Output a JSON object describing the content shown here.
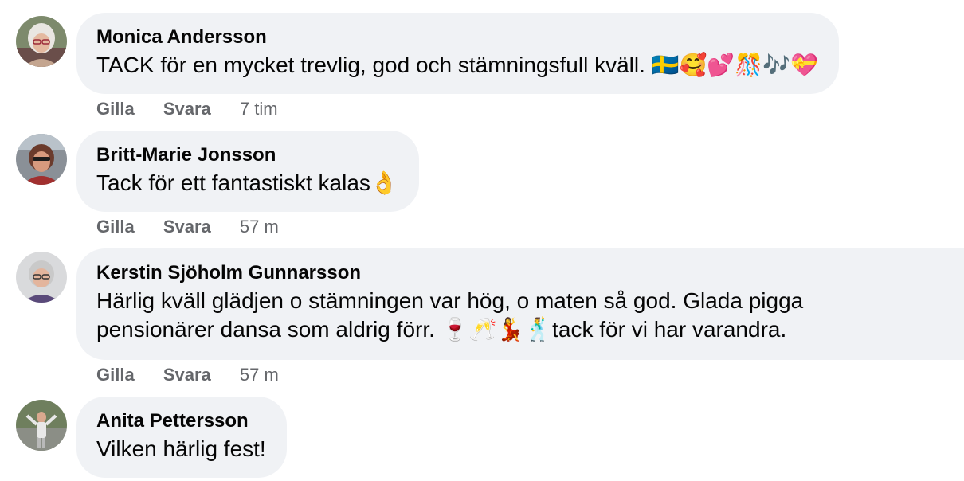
{
  "comments": [
    {
      "author": "Monica Andersson",
      "text": "TACK för en mycket trevlig, god och stämningsfull kväll. 🇸🇪🥰💕🎊🎶💝",
      "like_label": "Gilla",
      "reply_label": "Svara",
      "time": "7 tim",
      "avatar_icon": "avatar-photo-icon"
    },
    {
      "author": "Britt-Marie Jonsson",
      "text": "Tack för ett fantastiskt kalas👌",
      "like_label": "Gilla",
      "reply_label": "Svara",
      "time": "57 m",
      "avatar_icon": "avatar-photo-icon"
    },
    {
      "author": "Kerstin Sjöholm Gunnarsson",
      "text_line1": "Härlig kväll glädjen o stämningen var hög, o maten så god. Glada pigga",
      "text_line2": "pensionärer dansa som aldrig förr. 🍷🥂💃🕺tack för vi har varandra.",
      "like_label": "Gilla",
      "reply_label": "Svara",
      "time": "57 m",
      "avatar_icon": "avatar-photo-icon"
    },
    {
      "author": "Anita Pettersson",
      "text": "Vilken härlig fest!",
      "avatar_icon": "avatar-photo-icon"
    }
  ],
  "colors": {
    "bubble_bg": "#f0f2f5",
    "text_primary": "#050505",
    "text_secondary": "#65676b"
  }
}
